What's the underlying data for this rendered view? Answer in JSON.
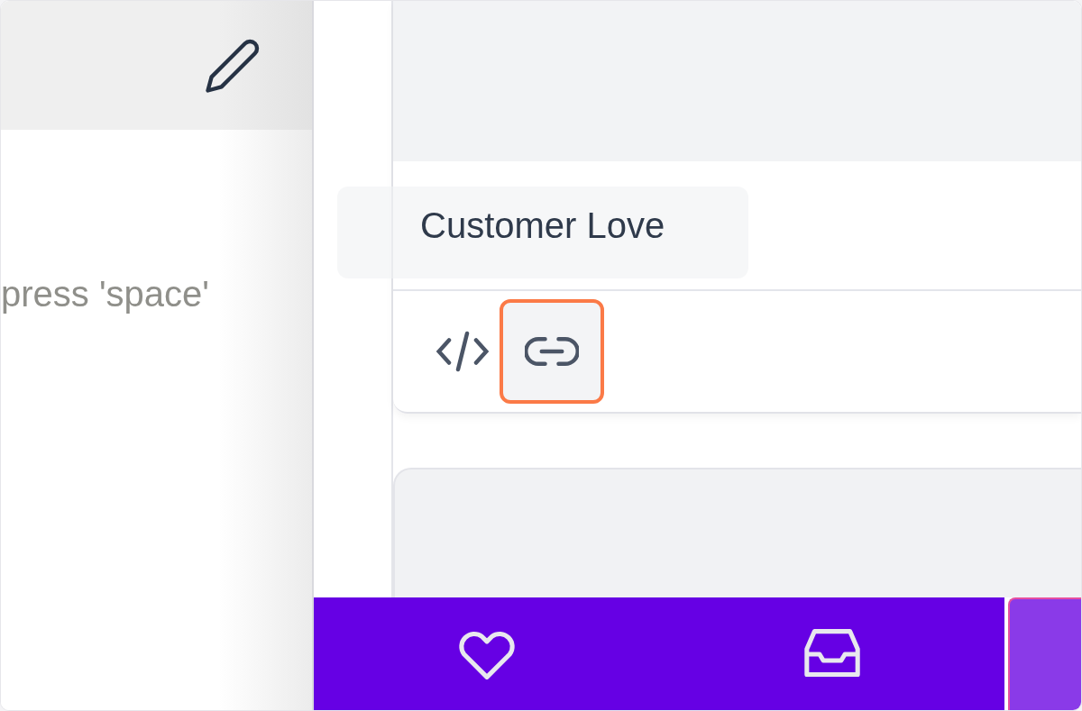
{
  "left_panel": {
    "hint": "press 'space'"
  },
  "widget_card": {
    "title": "Customer Love",
    "actions": [
      {
        "kind": "code",
        "selected": false
      },
      {
        "kind": "link",
        "selected": true
      }
    ]
  },
  "bottom_bar": {
    "items": [
      {
        "kind": "heart"
      },
      {
        "kind": "inbox"
      }
    ]
  }
}
